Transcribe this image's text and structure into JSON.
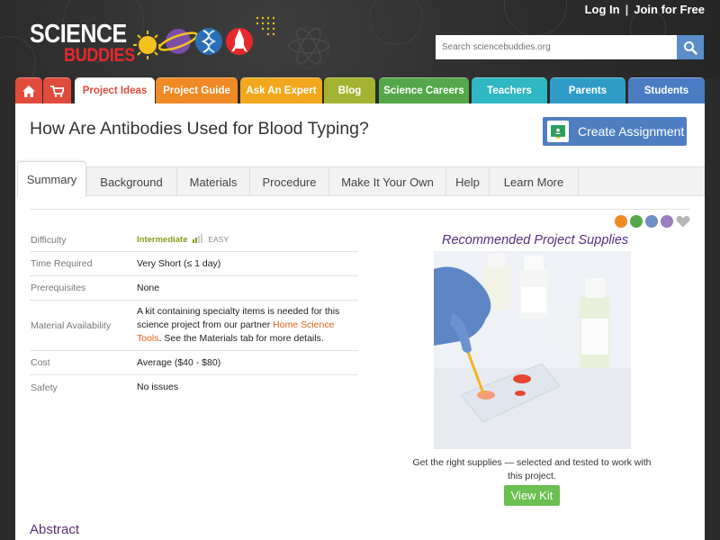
{
  "header": {
    "login_label": "Log In",
    "separator": "|",
    "join_label": "Join for Free",
    "logo_line1": "SCIENCE",
    "logo_line2": "BUDDIES",
    "search_placeholder": "Search sciencebuddies.org"
  },
  "nav": {
    "tabs": [
      {
        "label": "",
        "icon": "home-icon",
        "color": "#e04b3c"
      },
      {
        "label": "",
        "icon": "cart-icon",
        "color": "#e04b3c"
      },
      {
        "label": "Project Ideas",
        "color": "#ffffff",
        "active": true
      },
      {
        "label": "Project Guide",
        "color": "#f08a24"
      },
      {
        "label": "Ask An Expert",
        "color": "#f2a81d"
      },
      {
        "label": "Blog",
        "color": "#a3b331"
      },
      {
        "label": "Science Careers",
        "color": "#55a84a"
      },
      {
        "label": "Teachers",
        "color": "#2fb7c3"
      },
      {
        "label": "Parents",
        "color": "#2f9cc8"
      },
      {
        "label": "Students",
        "color": "#4a7cc4"
      }
    ]
  },
  "page": {
    "title": "How Are Antibodies Used for Blood Typing?",
    "create_assignment_label": "Create Assignment"
  },
  "subtabs": [
    "Summary",
    "Background",
    "Materials",
    "Procedure",
    "Make It Your Own",
    "Help",
    "Learn More"
  ],
  "summary": {
    "difficulty_label": "Difficulty",
    "difficulty_value": "Intermediate",
    "difficulty_easy": "EASY",
    "time_label": "Time Required",
    "time_value": "Very Short (≤ 1 day)",
    "prereq_label": "Prerequisites",
    "prereq_value": "None",
    "material_label": "Material Availability",
    "material_text_1": "A kit containing specialty items is needed for this science project from our partner ",
    "material_link": "Home Science Tools",
    "material_text_2": ". See the Materials tab for more details.",
    "cost_label": "Cost",
    "cost_value": "Average ($40 - $80)",
    "safety_label": "Safety",
    "safety_value": "No issues"
  },
  "supplies": {
    "title": "Recommended Project Supplies",
    "caption": "Get the right supplies — selected and tested to work with this project.",
    "button_label": "View Kit"
  },
  "abstract_heading": "Abstract",
  "colors": {
    "accent_purple": "#5a2d7d",
    "link_orange": "#e2601a",
    "button_blue": "#4f7fc2",
    "button_green": "#6ac050"
  }
}
